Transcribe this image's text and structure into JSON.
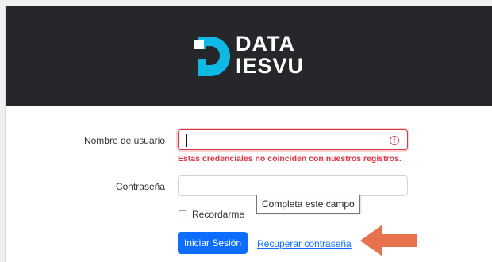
{
  "brand": {
    "line1": "DATA",
    "line2": "IESVU"
  },
  "form": {
    "username_label": "Nombre de usuario",
    "username_value": "",
    "username_error": "Estas credenciales no coinciden con nuestros registros.",
    "password_label": "Contraseña",
    "password_value": "",
    "remember_label": "Recordarme",
    "submit_label": "Iniciar Sesión",
    "recover_link": "Recuperar contraseña"
  },
  "tooltip": {
    "text": "Completa este campo"
  },
  "colors": {
    "header_bg": "#25272b",
    "logo_accent": "#0fb9e6",
    "primary": "#0d6efd",
    "error": "#dc3545",
    "arrow": "#e8724e"
  },
  "icons": {
    "error": "exclamation-circle-icon",
    "arrow": "left-arrow-icon"
  }
}
